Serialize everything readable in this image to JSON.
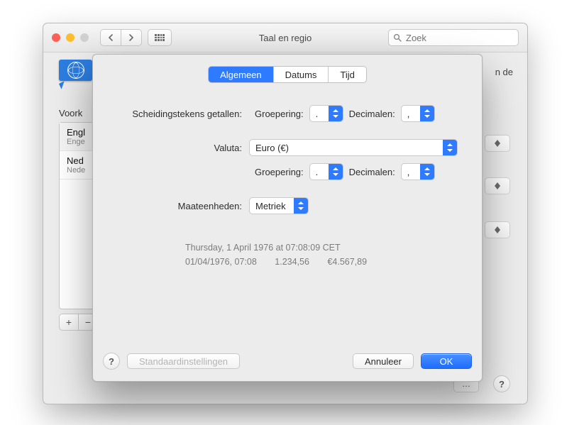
{
  "window": {
    "title": "Taal en regio",
    "search_placeholder": "Zoek",
    "hint_fragment": "n de",
    "voorkeur_label": "Voork",
    "languages": [
      {
        "name": "Engl",
        "sub": "Enge"
      },
      {
        "name": "Ned",
        "sub": "Nede"
      }
    ],
    "add": "+",
    "remove": "−",
    "more": "…"
  },
  "sheet": {
    "tabs": {
      "algemeen": "Algemeen",
      "datums": "Datums",
      "tijd": "Tijd"
    },
    "labels": {
      "scheiding": "Scheidingstekens getallen:",
      "groepering": "Groepering:",
      "decimalen": "Decimalen:",
      "valuta": "Valuta:",
      "maateenheden": "Maateenheden:"
    },
    "values": {
      "group_num": ".",
      "dec_num": ",",
      "currency": "Euro (€)",
      "group_cur": ".",
      "dec_cur": ",",
      "units": "Metriek"
    },
    "preview": {
      "line1": "Thursday, 1 April 1976 at 07:08:09 CET",
      "date": "01/04/1976, 07:08",
      "number": "1.234,56",
      "currency": "€4.567,89"
    },
    "buttons": {
      "defaults": "Standaardinstellingen",
      "cancel": "Annuleer",
      "ok": "OK"
    },
    "help": "?"
  }
}
